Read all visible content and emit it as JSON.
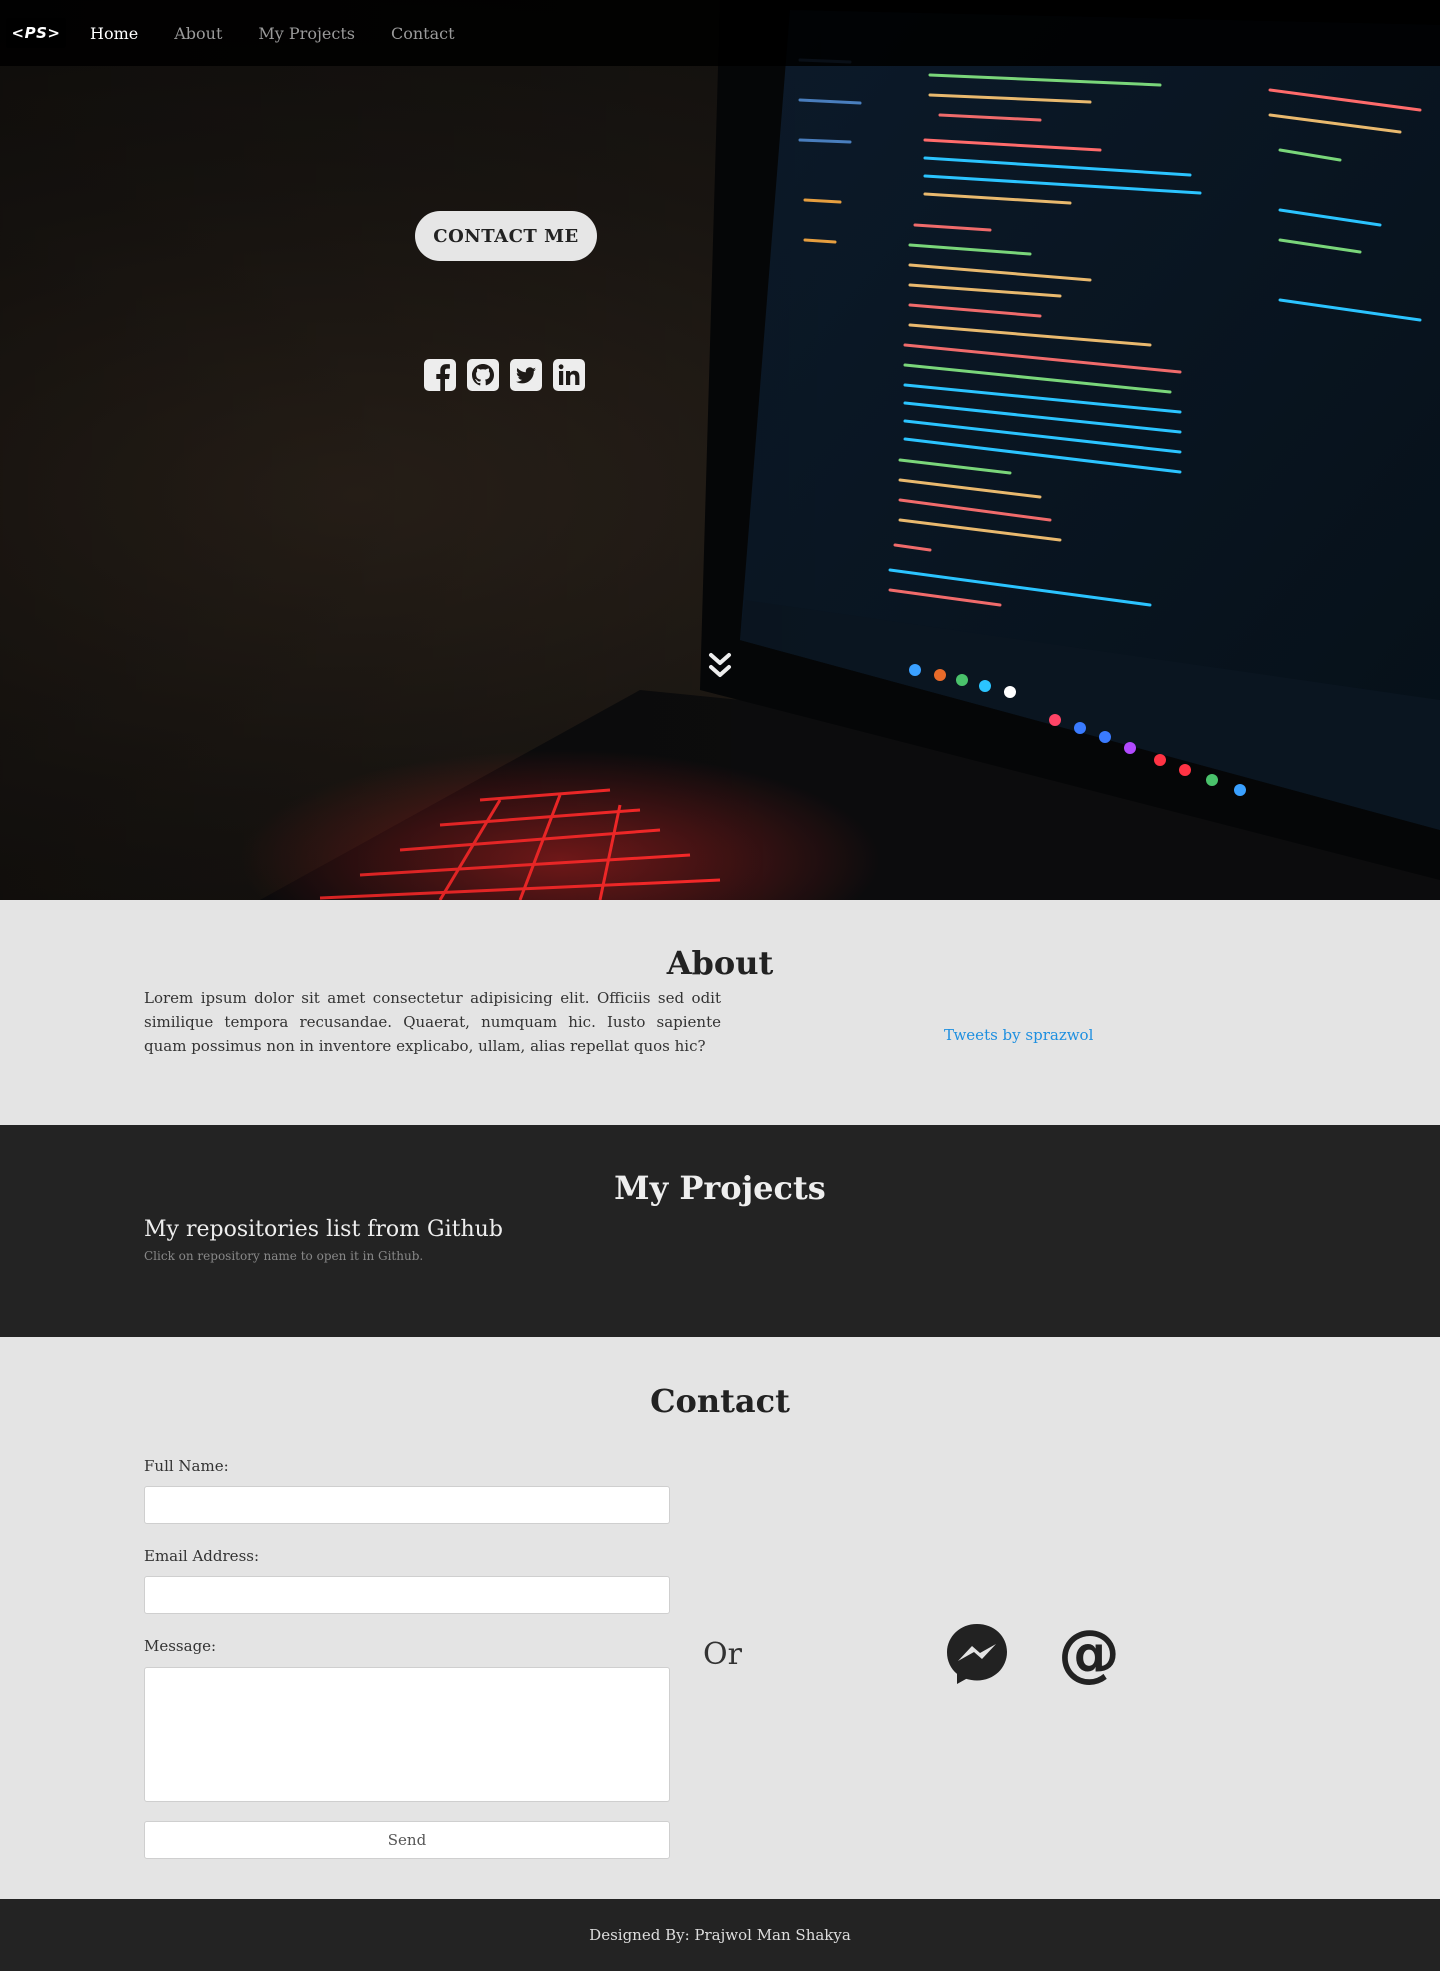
{
  "nav": {
    "brand": "<PS>",
    "links": [
      {
        "label": "Home",
        "active": true
      },
      {
        "label": "About",
        "active": false
      },
      {
        "label": "My Projects",
        "active": false
      },
      {
        "label": "Contact",
        "active": false
      }
    ]
  },
  "hero": {
    "contact_button": "CONTACT ME",
    "social_icons": [
      "facebook-icon",
      "github-icon",
      "twitter-icon",
      "linkedin-icon"
    ],
    "scroll_icon": "double-chevron-down-icon"
  },
  "about": {
    "title": "About",
    "text": "Lorem ipsum dolor sit amet consectetur adipisicing elit. Officiis sed odit similique tempora recusandae. Quaerat, numquam hic. Iusto sapiente quam possimus non in inventore explicabo, ullam, alias repellat quos hic?",
    "tweets_link": "Tweets by sprazwol"
  },
  "projects": {
    "title": "My Projects",
    "subtitle": "My repositories list from Github",
    "hint": "Click on repository name to open it in Github."
  },
  "contact": {
    "title": "Contact",
    "full_name_label": "Full Name:",
    "full_name_value": "",
    "email_label": "Email Address:",
    "email_value": "",
    "message_label": "Message:",
    "message_value": "",
    "send_label": "Send",
    "or_text": "Or",
    "alt_contact_icons": [
      "messenger-icon",
      "email-at-icon"
    ]
  },
  "footer": {
    "text": "Designed By: Prajwol Man Shakya"
  },
  "colors": {
    "nav_bg": "#0a0a0a",
    "section_light": "#e4e4e4",
    "section_dark": "#232323",
    "link_blue": "#1d8fe0",
    "accent_keyboard": "#ff1a1a",
    "code_cyan": "#2bc4ff"
  }
}
